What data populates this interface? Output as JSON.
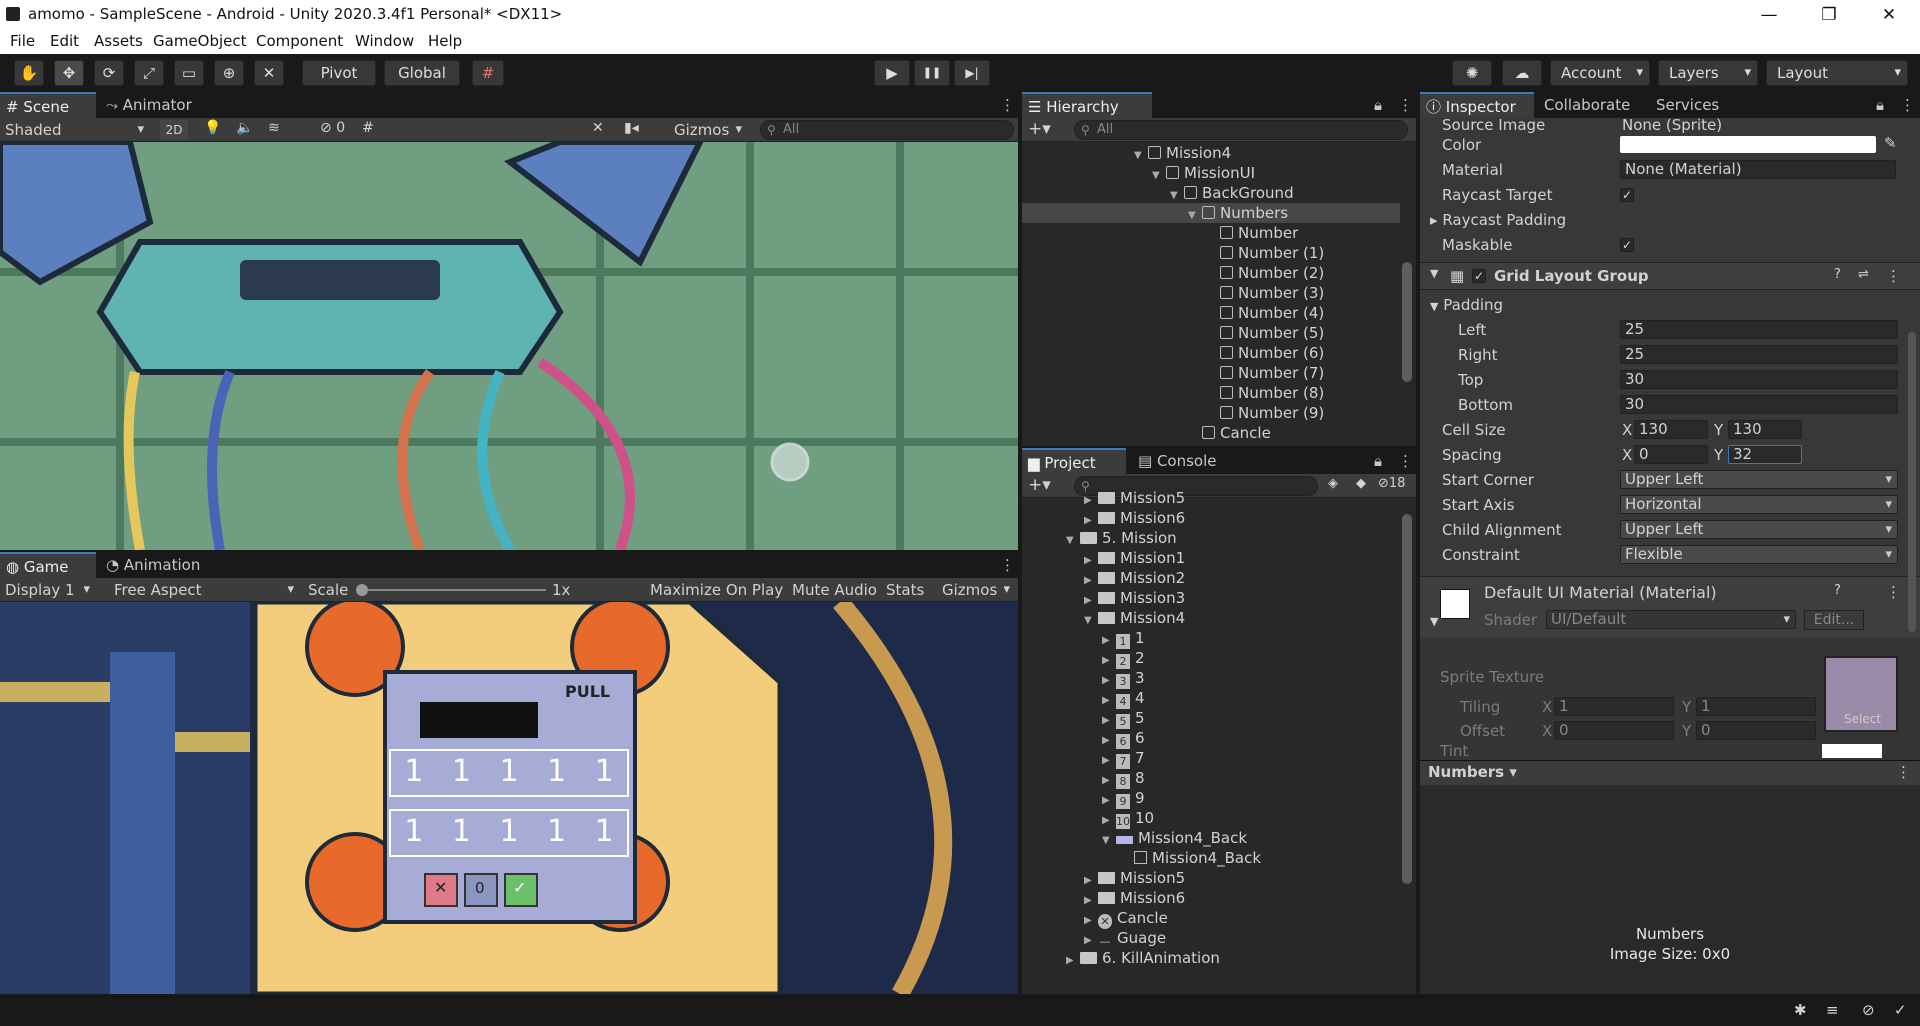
{
  "window": {
    "title": "amomo - SampleScene - Android - Unity 2020.3.4f1 Personal* <DX11>",
    "minimize": "—",
    "maximize": "❐",
    "close": "✕"
  },
  "menu": [
    "File",
    "Edit",
    "Assets",
    "GameObject",
    "Component",
    "Window",
    "Help"
  ],
  "toolbar": {
    "pivot": "Pivot",
    "global": "Global",
    "account": "Account",
    "layers": "Layers",
    "layout": "Layout",
    "play": "▶",
    "pause": "❚❚",
    "step": "▶|"
  },
  "scene": {
    "tabs": [
      "Scene",
      "Animator"
    ],
    "shading": "Shaded",
    "mode2d": "2D",
    "fx_count": "0",
    "gizmos": "Gizmos",
    "search_placeholder": "All"
  },
  "game": {
    "tabs": [
      "Game",
      "Animation"
    ],
    "display": "Display 1",
    "aspect": "Free Aspect",
    "scale_label": "Scale",
    "scale_value": "1x",
    "maximize": "Maximize On Play",
    "mute": "Mute Audio",
    "stats": "Stats",
    "gizmos": "Gizmos",
    "digits_row1": [
      "1",
      "1",
      "1",
      "1",
      "1"
    ],
    "digits_row2": [
      "1",
      "1",
      "1",
      "1",
      "1"
    ],
    "pull": "PULL",
    "reset": "0"
  },
  "hierarchy": {
    "title": "Hierarchy",
    "search_placeholder": "All",
    "items": [
      {
        "label": "Mission4",
        "depth": 0,
        "expanded": true
      },
      {
        "label": "MissionUI",
        "depth": 1,
        "expanded": true
      },
      {
        "label": "BackGround",
        "depth": 2,
        "expanded": true
      },
      {
        "label": "Numbers",
        "depth": 3,
        "expanded": true,
        "selected": true
      },
      {
        "label": "Number",
        "depth": 4
      },
      {
        "label": "Number (1)",
        "depth": 4
      },
      {
        "label": "Number (2)",
        "depth": 4
      },
      {
        "label": "Number (3)",
        "depth": 4
      },
      {
        "label": "Number (4)",
        "depth": 4
      },
      {
        "label": "Number (5)",
        "depth": 4
      },
      {
        "label": "Number (6)",
        "depth": 4
      },
      {
        "label": "Number (7)",
        "depth": 4
      },
      {
        "label": "Number (8)",
        "depth": 4
      },
      {
        "label": "Number (9)",
        "depth": 4
      },
      {
        "label": "Cancle",
        "depth": 3
      }
    ]
  },
  "project": {
    "tabs": [
      "Project",
      "Console"
    ],
    "hidden_count": "18",
    "items": [
      {
        "label": "Mission5",
        "depth": 1,
        "icon": "folder"
      },
      {
        "label": "Mission6",
        "depth": 1,
        "icon": "folder"
      },
      {
        "label": "5. Mission",
        "depth": 0,
        "icon": "folder",
        "expanded": true
      },
      {
        "label": "Mission1",
        "depth": 1,
        "icon": "folder"
      },
      {
        "label": "Mission2",
        "depth": 1,
        "icon": "folder"
      },
      {
        "label": "Mission3",
        "depth": 1,
        "icon": "folder"
      },
      {
        "label": "Mission4",
        "depth": 1,
        "icon": "folder",
        "expanded": true
      },
      {
        "label": "1",
        "depth": 2,
        "icon": "num",
        "n": "1"
      },
      {
        "label": "2",
        "depth": 2,
        "icon": "num",
        "n": "2"
      },
      {
        "label": "3",
        "depth": 2,
        "icon": "num",
        "n": "3"
      },
      {
        "label": "4",
        "depth": 2,
        "icon": "num",
        "n": "4"
      },
      {
        "label": "5",
        "depth": 2,
        "icon": "num",
        "n": "5"
      },
      {
        "label": "6",
        "depth": 2,
        "icon": "num",
        "n": "6"
      },
      {
        "label": "7",
        "depth": 2,
        "icon": "num",
        "n": "7"
      },
      {
        "label": "8",
        "depth": 2,
        "icon": "num",
        "n": "8"
      },
      {
        "label": "9",
        "depth": 2,
        "icon": "num",
        "n": "9"
      },
      {
        "label": "10",
        "depth": 2,
        "icon": "num",
        "n": "10"
      },
      {
        "label": "Mission4_Back",
        "depth": 2,
        "icon": "sprite",
        "expanded": true
      },
      {
        "label": "Mission4_Back",
        "depth": 3,
        "icon": "spriteitem"
      },
      {
        "label": "Mission5",
        "depth": 1,
        "icon": "folder"
      },
      {
        "label": "Mission6",
        "depth": 1,
        "icon": "folder"
      },
      {
        "label": "Cancle",
        "depth": 1,
        "icon": "cancel"
      },
      {
        "label": "Guage",
        "depth": 1,
        "icon": "line"
      },
      {
        "label": "6. KillAnimation",
        "depth": 0,
        "icon": "folder"
      }
    ]
  },
  "inspector": {
    "tabs": [
      "Inspector",
      "Collaborate",
      "Services"
    ],
    "source_image_label": "Source Image",
    "source_image_value": "None (Sprite)",
    "color_label": "Color",
    "material_label": "Material",
    "material_value": "None (Material)",
    "raycast_target_label": "Raycast Target",
    "raycast_padding_label": "Raycast Padding",
    "maskable_label": "Maskable",
    "grid_title": "Grid Layout Group",
    "padding_label": "Padding",
    "left_label": "Left",
    "left": "25",
    "right_label": "Right",
    "right": "25",
    "top_label": "Top",
    "top": "30",
    "bottom_label": "Bottom",
    "bottom": "30",
    "cell_size_label": "Cell Size",
    "cell_x": "130",
    "cell_y": "130",
    "spacing_label": "Spacing",
    "spacing_x": "0",
    "spacing_y": "32",
    "x": "X",
    "y": "Y",
    "start_corner_label": "Start Corner",
    "start_corner": "Upper Left",
    "start_axis_label": "Start Axis",
    "start_axis": "Horizontal",
    "child_alignment_label": "Child Alignment",
    "child_alignment": "Upper Left",
    "constraint_label": "Constraint",
    "constraint": "Flexible",
    "material_title": "Default UI Material (Material)",
    "shader_label": "Shader",
    "shader_value": "UI/Default",
    "edit": "Edit...",
    "sprite_texture": "Sprite Texture",
    "tiling": "Tiling",
    "tiling_x": "1",
    "tiling_y": "1",
    "offset": "Offset",
    "offset_x": "0",
    "offset_y": "0",
    "tint": "Tint",
    "select": "Select",
    "preview_dropdown": "Numbers",
    "preview_name": "Numbers",
    "preview_size": "Image Size: 0x0"
  }
}
